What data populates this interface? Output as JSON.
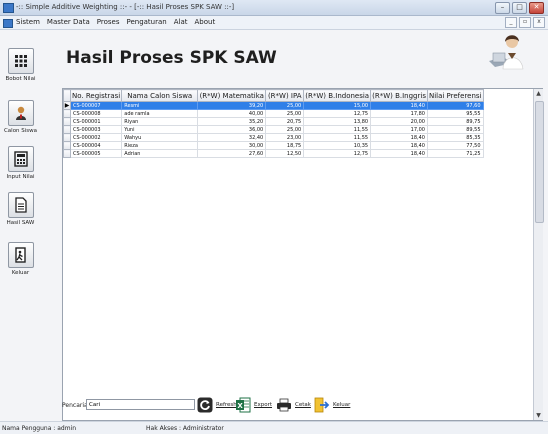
{
  "window": {
    "title": "-:: Simple Additive Weighting ::- - [-:: Hasil Proses SPK SAW ::-]"
  },
  "menu": {
    "items": [
      "Sistem",
      "Master Data",
      "Proses",
      "Pengaturan",
      "Alat",
      "About"
    ]
  },
  "sidebar": {
    "items": [
      {
        "label": "Bobot Nilai",
        "icon": "grid-icon"
      },
      {
        "label": "Calon Siswa",
        "icon": "user-icon"
      },
      {
        "label": "Input Nilai",
        "icon": "calculator-icon"
      },
      {
        "label": "Hasil SAW",
        "icon": "document-icon"
      },
      {
        "label": "Keluar",
        "icon": "exit-door-icon"
      }
    ]
  },
  "page": {
    "title": "Hasil Proses SPK SAW"
  },
  "table": {
    "columns": [
      "No. Registrasi",
      "Nama Calon Siswa",
      "(R*W) Matematika",
      "(R*W) IPA",
      "(R*W) B.Indonesia",
      "(R*W) B.Inggris",
      "Nilai Preferensi"
    ],
    "rows": [
      [
        "CS-000007",
        "Resmi",
        "39,20",
        "25,00",
        "15,00",
        "18,40",
        "97,60"
      ],
      [
        "CS-000008",
        "ade ramla",
        "40,00",
        "25,00",
        "12,75",
        "17,80",
        "95,55"
      ],
      [
        "CS-000001",
        "Riyan",
        "35,20",
        "20,75",
        "13,80",
        "20,00",
        "89,75"
      ],
      [
        "CS-000003",
        "Yuni",
        "36,00",
        "25,00",
        "11,55",
        "17,00",
        "89,55"
      ],
      [
        "CS-000002",
        "Wahyu",
        "32,40",
        "23,00",
        "11,55",
        "18,40",
        "85,35"
      ],
      [
        "CS-000004",
        "Rieza",
        "30,00",
        "18,75",
        "10,35",
        "18,40",
        "77,50"
      ],
      [
        "CS-000005",
        "Adrian",
        "27,60",
        "12,50",
        "12,75",
        "18,40",
        "71,25"
      ]
    ],
    "selected_index": 0
  },
  "search": {
    "label": "Pencarian",
    "value": "Cari"
  },
  "actions": {
    "refresh": "Refresh",
    "export": "Export",
    "print": "Cetak",
    "exit": "Keluar"
  },
  "status": {
    "user": "Nama Pengguna :  admin",
    "access": "Hak Akses :   Administrator"
  },
  "colors": {
    "selection": "#2f7fe8",
    "title_bar": "#c9d6e8"
  }
}
